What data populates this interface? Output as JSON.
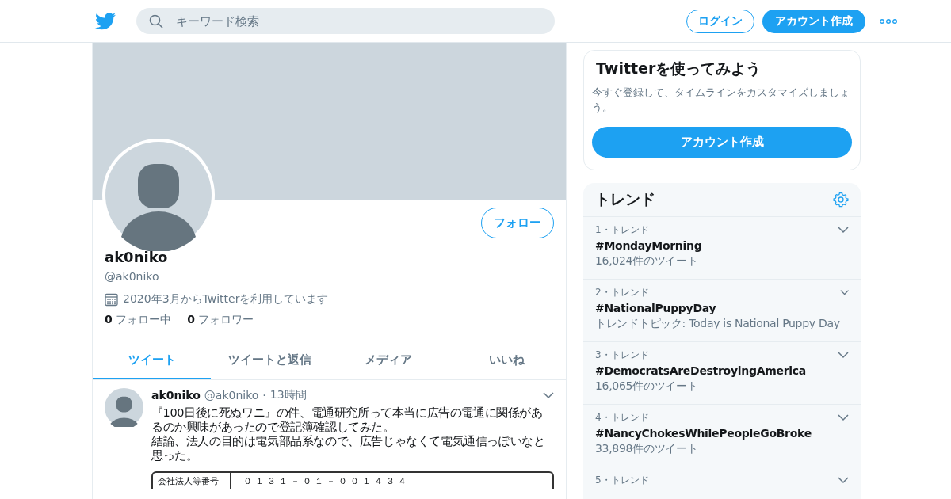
{
  "header": {
    "search": {
      "placeholder": "キーワード検索"
    },
    "login": "ログイン",
    "signup": "アカウント作成"
  },
  "profile": {
    "name": "ak0niko",
    "handle": "@ak0niko",
    "follow": "フォロー",
    "joined": "2020年3月からTwitterを利用しています",
    "stats": [
      {
        "count": "0",
        "label": "フォロー中"
      },
      {
        "count": "0",
        "label": "フォロワー"
      }
    ]
  },
  "tabs": [
    {
      "label": "ツイート",
      "selected": true
    },
    {
      "label": "ツイートと返信",
      "selected": false
    },
    {
      "label": "メディア",
      "selected": false
    },
    {
      "label": "いいね",
      "selected": false
    }
  ],
  "tweet": {
    "name": "ak0niko",
    "handle": "@ak0niko",
    "separator": "·",
    "time": "13時間",
    "paragraphs": [
      "『100日後に死ぬワニ』の件、電通研究所って本当に広告の電通に関係があるのか興味があったので登記簿確認してみた。",
      "結論、法人の目的は電気部品系なので、広告じゃなくて電気通信っぽいなと思った。"
    ],
    "document": {
      "label": "会社法人等番号",
      "value": "０１３１－０１－００１４３４"
    }
  },
  "signup_card": {
    "title": "Twitterを使ってみよう",
    "text": "今すぐ登録して、タイムラインをカスタマイズしましょう。",
    "button": "アカウント作成"
  },
  "trends": {
    "title": "トレンド",
    "items": [
      {
        "rank": "1・トレンド",
        "name": "#MondayMorning",
        "meta": "16,024件のツイート"
      },
      {
        "rank": "2・トレンド",
        "name": "#NationalPuppyDay",
        "meta": "トレンドトピック: Today is National Puppy Day"
      },
      {
        "rank": "3・トレンド",
        "name": "#DemocratsAreDestroyingAmerica",
        "meta": "16,065件のツイート"
      },
      {
        "rank": "4・トレンド",
        "name": "#NancyChokesWhilePeopleGoBroke",
        "meta": "33,898件のツイート"
      },
      {
        "rank": "5・トレンド"
      }
    ]
  }
}
